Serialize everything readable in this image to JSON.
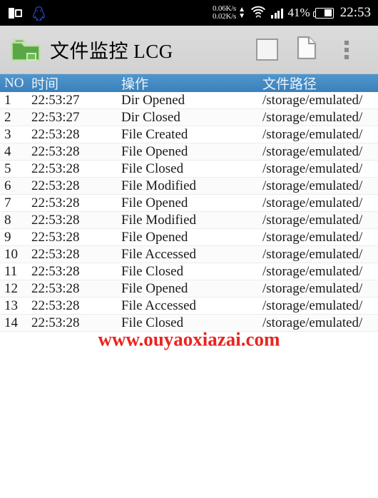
{
  "status_bar": {
    "left_icons": [
      "multiwindow-icon",
      "qq-icon"
    ],
    "network_up": "0.06K/s",
    "network_down": "0.02K/s",
    "arrow_up": "▲",
    "arrow_down": "▼",
    "wifi": "wifi-icon",
    "signal": "signal-icon",
    "battery_percent": "41%",
    "battery": "battery-icon",
    "clock": "22:53",
    "background_color": "#000000",
    "text_color": "#ffffff"
  },
  "app_bar": {
    "folder_icon": "folder-icon",
    "title": "文件监控 LCG",
    "actions": [
      {
        "name": "stop-button",
        "icon": "stop-square-icon"
      },
      {
        "name": "file-button",
        "icon": "document-icon"
      },
      {
        "name": "overflow-menu-button",
        "icon": "overflow-menu-icon"
      }
    ],
    "background_color": "#d6d6d6",
    "accent_color": "#4a9b3f"
  },
  "table": {
    "header_background": "#3f87c2",
    "header_text_color": "#eaf3fa",
    "columns": [
      {
        "key": "no",
        "label": "NO"
      },
      {
        "key": "time",
        "label": "时间"
      },
      {
        "key": "op",
        "label": "操作"
      },
      {
        "key": "path",
        "label": "文件路径"
      }
    ],
    "rows": [
      {
        "no": "1",
        "time": "22:53:27",
        "op": "Dir Opened",
        "path": "/storage/emulated/"
      },
      {
        "no": "2",
        "time": "22:53:27",
        "op": "Dir Closed",
        "path": "/storage/emulated/"
      },
      {
        "no": "3",
        "time": "22:53:28",
        "op": "File Created",
        "path": "/storage/emulated/"
      },
      {
        "no": "4",
        "time": "22:53:28",
        "op": "File Opened",
        "path": "/storage/emulated/"
      },
      {
        "no": "5",
        "time": "22:53:28",
        "op": "File Closed",
        "path": "/storage/emulated/"
      },
      {
        "no": "6",
        "time": "22:53:28",
        "op": "File Modified",
        "path": "/storage/emulated/"
      },
      {
        "no": "7",
        "time": "22:53:28",
        "op": "File Opened",
        "path": "/storage/emulated/"
      },
      {
        "no": "8",
        "time": "22:53:28",
        "op": "File Modified",
        "path": "/storage/emulated/"
      },
      {
        "no": "9",
        "time": "22:53:28",
        "op": "File Opened",
        "path": "/storage/emulated/"
      },
      {
        "no": "10",
        "time": "22:53:28",
        "op": "File Accessed",
        "path": "/storage/emulated/"
      },
      {
        "no": "11",
        "time": "22:53:28",
        "op": "File Closed",
        "path": "/storage/emulated/"
      },
      {
        "no": "12",
        "time": "22:53:28",
        "op": "File Opened",
        "path": "/storage/emulated/"
      },
      {
        "no": "13",
        "time": "22:53:28",
        "op": "File Accessed",
        "path": "/storage/emulated/"
      },
      {
        "no": "14",
        "time": "22:53:28",
        "op": "File Closed",
        "path": "/storage/emulated/"
      }
    ]
  },
  "watermark": {
    "text": "www.ouyaoxiazai.com",
    "color": "#e8251f"
  }
}
